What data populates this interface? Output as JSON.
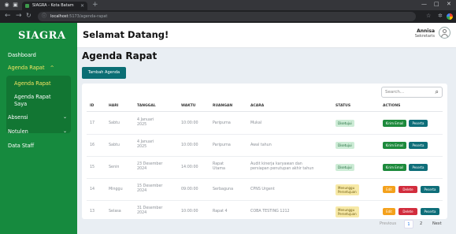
{
  "browser": {
    "tab_title": "SIAGRA - Kota Batam",
    "url_host": "localhost",
    "url_path": ":5173/agenda-rapat"
  },
  "sidebar": {
    "brand": "SIAGRA",
    "items": [
      {
        "label": "Dashboard"
      },
      {
        "label": "Agenda Rapat"
      },
      {
        "label": "Absensi"
      },
      {
        "label": "Notulen"
      },
      {
        "label": "Data Staff"
      }
    ],
    "sub_items": [
      {
        "label": "Agenda Rapat"
      },
      {
        "label": "Agenda Rapat"
      },
      {
        "label": "Saya"
      }
    ]
  },
  "header": {
    "welcome": "Selamat Datang!",
    "user_name": "Annisa",
    "user_role": "Sekretaris"
  },
  "main": {
    "title": "Agenda Rapat",
    "add_button": "Tambah Agenda",
    "search_placeholder": "Search...",
    "columns": [
      "ID",
      "HARI",
      "TANGGAL",
      "WAKTU",
      "RUANGAN",
      "ACARA",
      "STATUS",
      "ACTIONS"
    ],
    "rows": [
      {
        "id": "17",
        "hari": "Sabtu",
        "tanggal1": "4 Januari",
        "tanggal2": "2025",
        "waktu": "10:00:00",
        "ruangan1": "Paripurna",
        "ruangan2": "",
        "acara1": "Mukal",
        "acara2": "",
        "status1": "Disetujui",
        "status2": ""
      },
      {
        "id": "16",
        "hari": "Sabtu",
        "tanggal1": "4 Januari",
        "tanggal2": "2025",
        "waktu": "10:00:00",
        "ruangan1": "Paripurna",
        "ruangan2": "",
        "acara1": "Awal tahun",
        "acara2": "",
        "status1": "Disetujui",
        "status2": ""
      },
      {
        "id": "15",
        "hari": "Senin",
        "tanggal1": "23 Desember",
        "tanggal2": "2024",
        "waktu": "14:00:00",
        "ruangan1": "Rapat",
        "ruangan2": "Utama",
        "acara1": "Audit kinerja karyawan dan",
        "acara2": "persiapan penutupan akhir tahun",
        "status1": "Disetujui",
        "status2": ""
      },
      {
        "id": "14",
        "hari": "Minggu",
        "tanggal1": "15 Desember",
        "tanggal2": "2024",
        "waktu": "09:00:00",
        "ruangan1": "Serbaguna",
        "ruangan2": "",
        "acara1": "CPNS Urgent",
        "acara2": "",
        "status1": "Menunggu",
        "status2": "Persetujuan"
      },
      {
        "id": "13",
        "hari": "Selasa",
        "tanggal1": "31 Desember",
        "tanggal2": "2024",
        "waktu": "10:00:00",
        "ruangan1": "Rapat 4",
        "ruangan2": "",
        "acara1": "COBA TESTING 1212",
        "acara2": "",
        "status1": "Menunggu",
        "status2": "Persetujuan"
      }
    ],
    "actions": {
      "kirim_email": "Kirim Email",
      "peserta": "Peserta",
      "edit": "Edit",
      "delete": "Delete"
    },
    "pagination": {
      "previous": "Previous",
      "page1": "1",
      "page2": "2",
      "next": "Next"
    }
  },
  "colors": {
    "sidebar": "#168a3e",
    "accent_yellow": "#f5e663",
    "teal": "#0e6e79"
  }
}
